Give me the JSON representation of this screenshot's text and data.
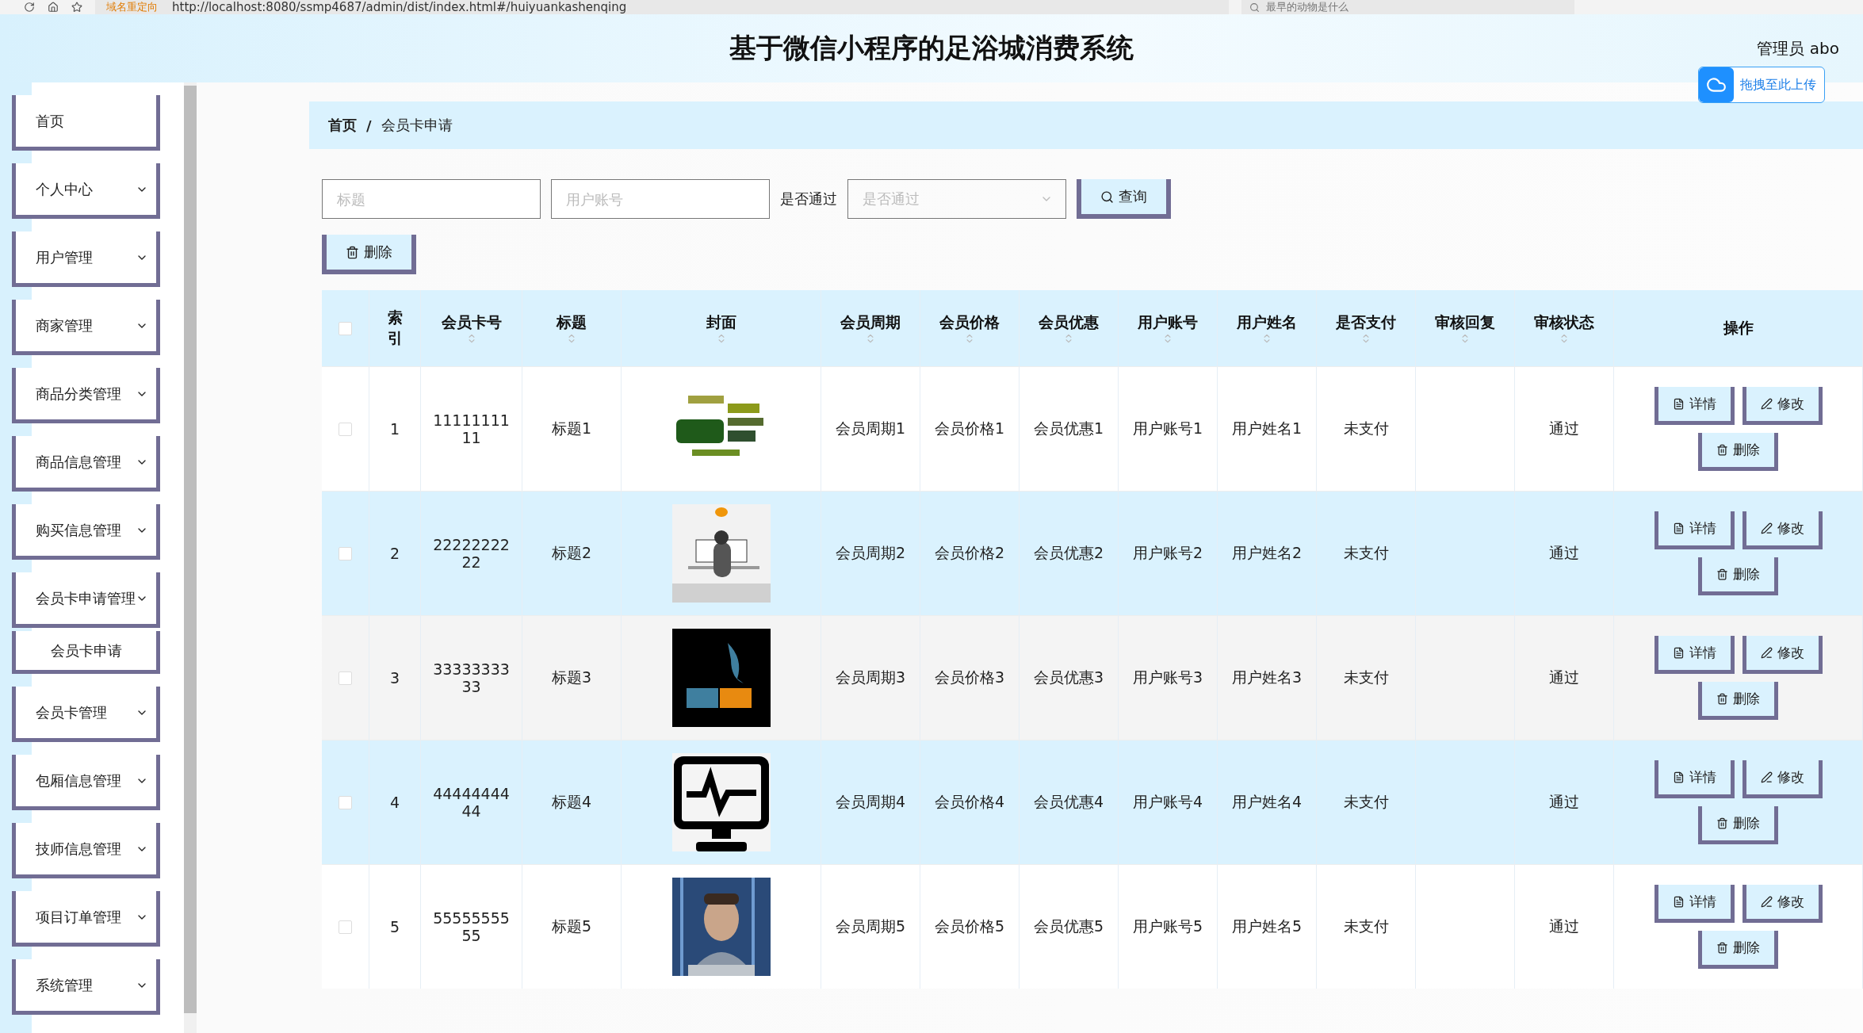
{
  "browser": {
    "redirect_label": "域名重定向",
    "url": "http://localhost:8080/ssmp4687/admin/dist/index.html#/huiyuankashenqing",
    "search": "最早的动物是什么"
  },
  "header": {
    "title": "基于微信小程序的足浴城消费系统",
    "user": "管理员 abo",
    "upload": "拖拽至此上传"
  },
  "sidebar": {
    "items": [
      {
        "label": "首页",
        "kind": "link"
      },
      {
        "label": "个人中心",
        "kind": "menu"
      },
      {
        "label": "用户管理",
        "kind": "menu"
      },
      {
        "label": "商家管理",
        "kind": "menu"
      },
      {
        "label": "商品分类管理",
        "kind": "menu"
      },
      {
        "label": "商品信息管理",
        "kind": "menu"
      },
      {
        "label": "购买信息管理",
        "kind": "menu"
      },
      {
        "label": "会员卡申请管理",
        "kind": "menu",
        "children": [
          {
            "label": "会员卡申请",
            "kind": "link"
          }
        ]
      },
      {
        "label": "会员卡管理",
        "kind": "menu"
      },
      {
        "label": "包厢信息管理",
        "kind": "menu"
      },
      {
        "label": "技师信息管理",
        "kind": "menu"
      },
      {
        "label": "项目订单管理",
        "kind": "menu"
      },
      {
        "label": "系统管理",
        "kind": "menu"
      }
    ]
  },
  "breadcrumb": {
    "separator": "/",
    "items": [
      "首页",
      "会员卡申请"
    ]
  },
  "filters": {
    "fields": [
      {
        "placeholder": "标题"
      },
      {
        "placeholder": "用户账号"
      }
    ],
    "select": {
      "label": "是否通过",
      "placeholder": "是否通过"
    },
    "search_button": "查询"
  },
  "delete_button": "删除",
  "table": {
    "select_all": {
      "checked": false
    },
    "columns": [
      {
        "label": "索引",
        "sortable": false
      },
      {
        "label": "会员卡号",
        "sortable": true
      },
      {
        "label": "标题",
        "sortable": true
      },
      {
        "label": "封面",
        "sortable": true
      },
      {
        "label": "会员周期",
        "sortable": true
      },
      {
        "label": "会员价格",
        "sortable": true
      },
      {
        "label": "会员优惠",
        "sortable": true
      },
      {
        "label": "用户账号",
        "sortable": true
      },
      {
        "label": "用户姓名",
        "sortable": true
      },
      {
        "label": "是否支付",
        "sortable": true
      },
      {
        "label": "审核回复",
        "sortable": true
      },
      {
        "label": "审核状态",
        "sortable": true
      },
      {
        "label": "操作",
        "sortable": false
      }
    ],
    "rows": [
      {
        "checked": false,
        "cells": [
          "1",
          "1111111111",
          "标题1",
          {
            "kind": "picture"
          },
          "会员周期1",
          "会员价格1",
          "会员优惠1",
          "用户账号1",
          "用户姓名1",
          "未支付",
          null,
          "通过"
        ],
        "actions": [
          "详情",
          "修改",
          "删除"
        ]
      },
      {
        "checked": false,
        "cells": [
          "2",
          "2222222222",
          "标题2",
          {
            "kind": "picture"
          },
          "会员周期2",
          "会员价格2",
          "会员优惠2",
          "用户账号2",
          "用户姓名2",
          "未支付",
          null,
          "通过"
        ],
        "actions": [
          "详情",
          "修改",
          "删除"
        ]
      },
      {
        "checked": false,
        "cells": [
          "3",
          "3333333333",
          "标题3",
          {
            "kind": "picture"
          },
          "会员周期3",
          "会员价格3",
          "会员优惠3",
          "用户账号3",
          "用户姓名3",
          "未支付",
          null,
          "通过"
        ],
        "actions": [
          "详情",
          "修改",
          "删除"
        ]
      },
      {
        "checked": false,
        "cells": [
          "4",
          "4444444444",
          "标题4",
          {
            "kind": "picture"
          },
          "会员周期4",
          "会员价格4",
          "会员优惠4",
          "用户账号4",
          "用户姓名4",
          "未支付",
          null,
          "通过"
        ],
        "actions": [
          "详情",
          "修改",
          "删除"
        ]
      },
      {
        "checked": false,
        "cells": [
          "5",
          "5555555555",
          "标题5",
          {
            "kind": "picture"
          },
          "会员周期5",
          "会员价格5",
          "会员优惠5",
          "用户账号5",
          "用户姓名5",
          "未支付",
          null,
          "通过"
        ],
        "actions": [
          "详情",
          "修改",
          "删除"
        ]
      }
    ]
  }
}
